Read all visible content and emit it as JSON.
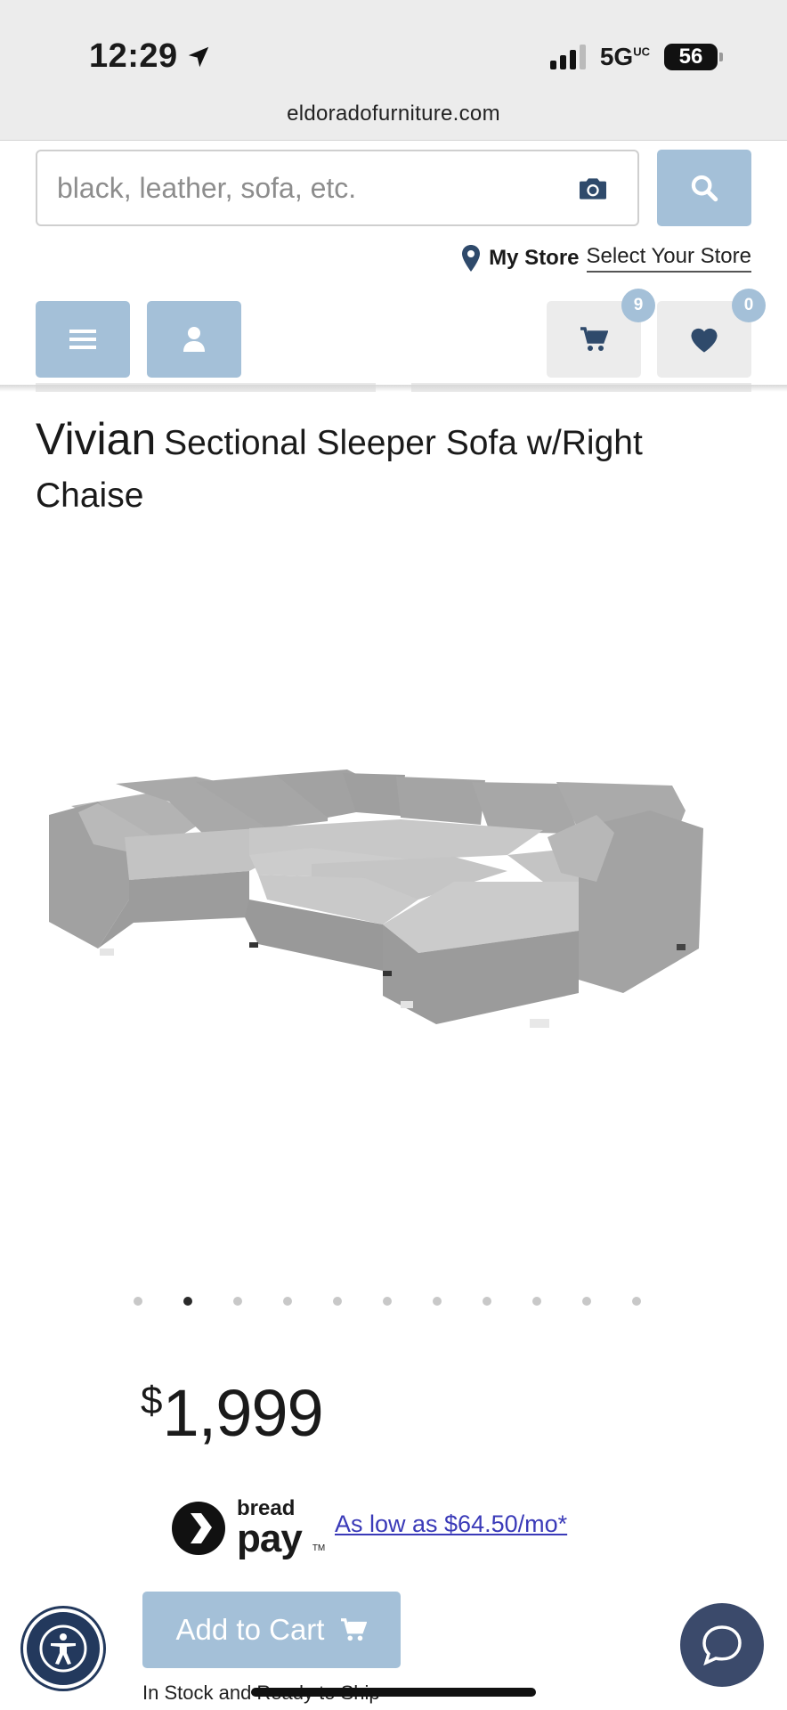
{
  "status_bar": {
    "time": "12:29",
    "network": "5G",
    "network_sup": "UC",
    "battery": "56"
  },
  "browser": {
    "url": "eldoradofurniture.com"
  },
  "search": {
    "placeholder": "black, leather, sofa, etc."
  },
  "store": {
    "label": "My Store",
    "select_link": "Select Your Store"
  },
  "header": {
    "cart_count": "9",
    "wishlist_count": "0"
  },
  "product": {
    "name": "Vivian",
    "description": "Sectional Sleeper Sofa w/Right Chaise",
    "currency_symbol": "$",
    "price": "1,999",
    "image_alt": "Gray sectional sleeper sofa",
    "carousel": {
      "total": 11,
      "active_index": 1
    }
  },
  "financing": {
    "brand_small": "bread",
    "brand_big": "pay",
    "trademark": "TM",
    "offer": "As low as $64.50/mo*"
  },
  "actions": {
    "add_to_cart": "Add to Cart",
    "stock_status": "In Stock and Ready to Ship"
  },
  "colors": {
    "accent": "#a4c0d8",
    "navy": "#23395d",
    "link": "#3a3ab8"
  }
}
